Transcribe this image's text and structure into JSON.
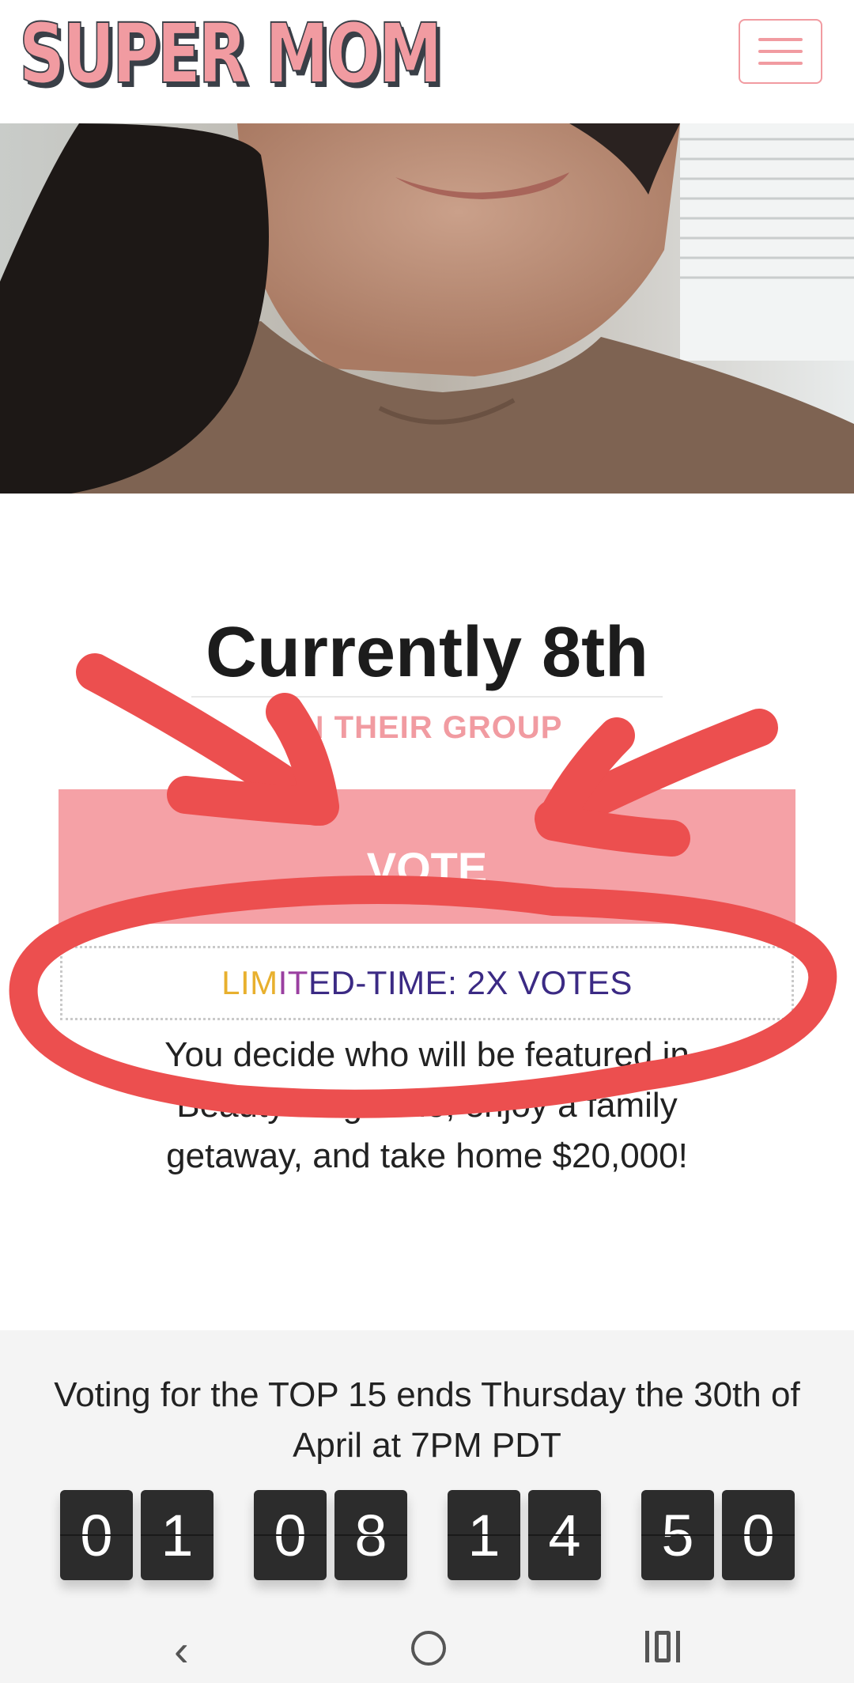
{
  "header": {
    "logo": "SUPER MOM"
  },
  "rank": {
    "title": "Currently 8th",
    "subtitle": "IN THEIR GROUP"
  },
  "vote_button": {
    "label": "VOTE"
  },
  "promo": {
    "part1": "LIM",
    "part2": "IT",
    "part3": "ED-TIME: 2X VOTES"
  },
  "description": "You decide who will be featured in Beauty Magazine, enjoy a family getaway, and take home $20,000!",
  "voting": {
    "text": "Voting for the TOP 15 ends Thursday the 30th of April at 7PM PDT",
    "countdown": [
      "0",
      "1",
      "0",
      "8",
      "1",
      "4",
      "5",
      "0"
    ]
  },
  "colors": {
    "brand_pink": "#f19ba1",
    "annotation_red": "#ec4f4f"
  },
  "icons": {
    "menu": "hamburger-icon",
    "back": "back-icon",
    "home": "home-icon",
    "recent": "recent-apps-icon"
  }
}
